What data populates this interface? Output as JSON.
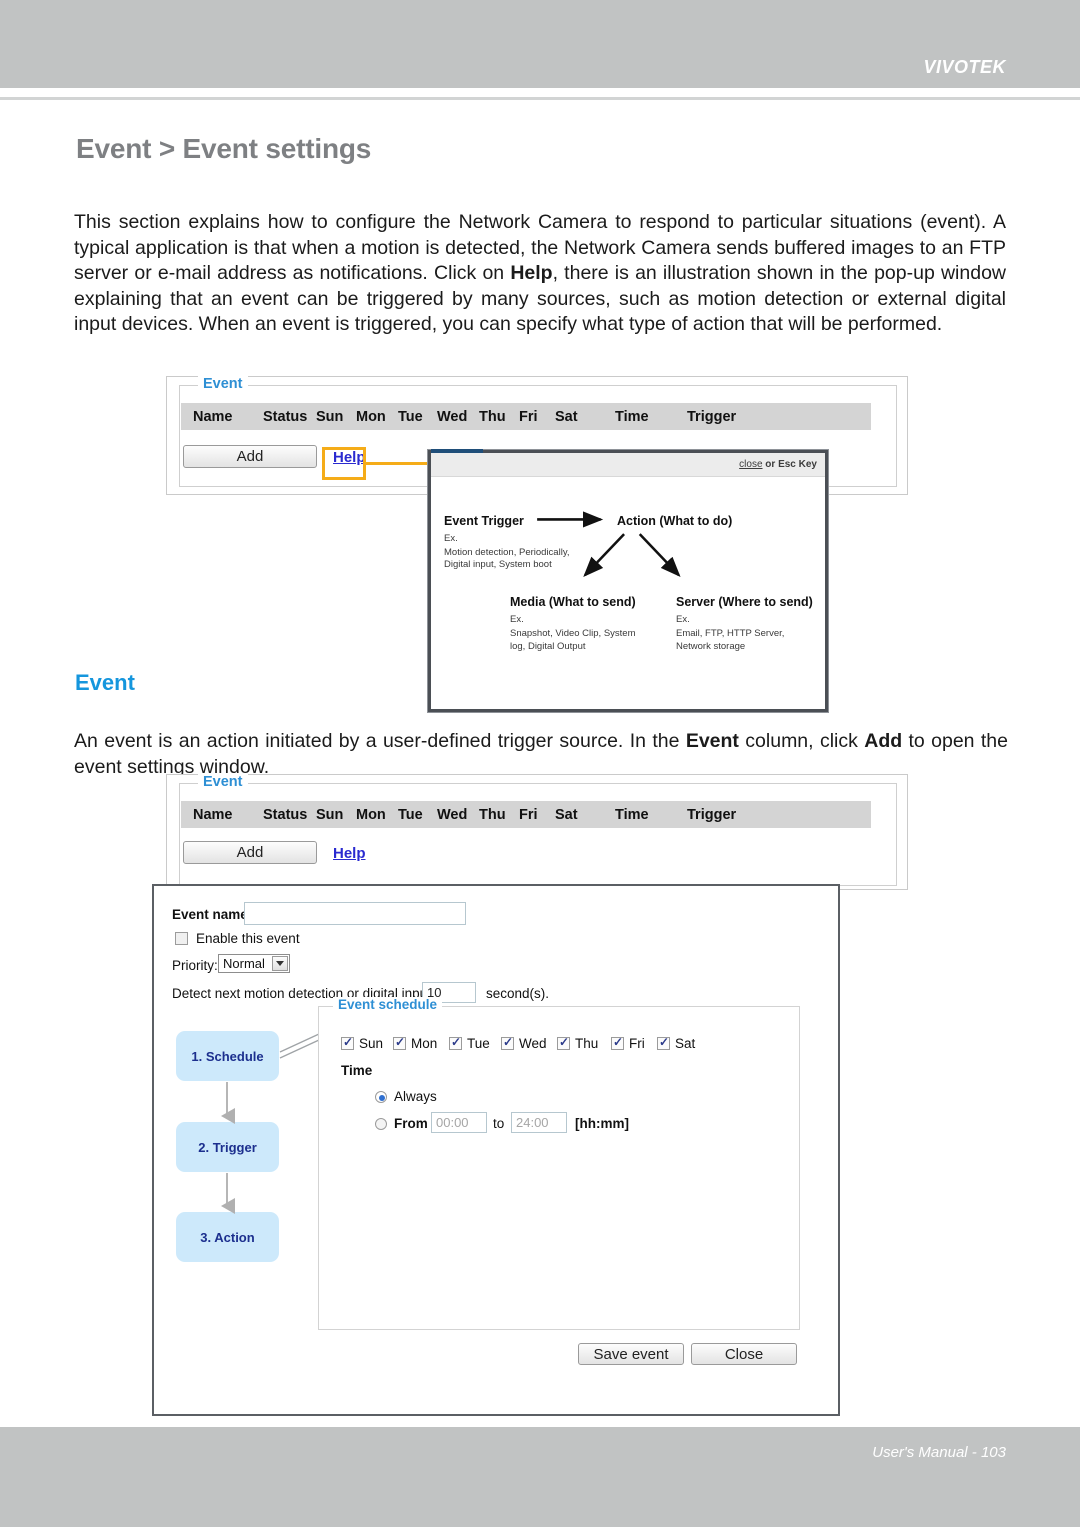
{
  "header": {
    "brand": "VIVOTEK"
  },
  "page": {
    "title": "Event > Event settings",
    "paragraph1_html": "This section explains how to configure the Network Camera to respond to particular situations (event). A typical application is that when a motion is detected, the Network Camera sends buffered images to an FTP server or e-mail address as notifications. Click on <b>Help</b>, there is an illustration shown in the pop-up window explaining that an event can be triggered by many sources, such as motion detection or external digital input devices. When an event is triggered, you can specify what type of action that will be performed.",
    "section_heading": "Event",
    "paragraph2_html": "An event is an action initiated by a user-defined trigger source. In the <b>Event</b> column, click <b>Add</b> to open the event settings window.",
    "footer": "User's Manual - 103"
  },
  "event_panel": {
    "legend": "Event",
    "columns": [
      "Name",
      "Status",
      "Sun",
      "Mon",
      "Tue",
      "Wed",
      "Thu",
      "Fri",
      "Sat",
      "Time",
      "Trigger"
    ],
    "add_label": "Add",
    "help_label": "Help"
  },
  "help_popup": {
    "close_text_link": "close",
    "close_text_rest": " or Esc Key",
    "nodes": [
      {
        "title": "Event Trigger",
        "ex_label": "Ex.",
        "ex_lines": [
          "Motion detection, Periodically,",
          "Digital input, System boot"
        ]
      },
      {
        "title": "Action (What to do)",
        "ex_label": "",
        "ex_lines": []
      },
      {
        "title": "Media (What to send)",
        "ex_label": "Ex.",
        "ex_lines": [
          "Snapshot, Video Clip, System",
          "log, Digital Output"
        ]
      },
      {
        "title": "Server (Where to send)",
        "ex_label": "Ex.",
        "ex_lines": [
          "Email, FTP, HTTP Server,",
          "Network storage"
        ]
      }
    ]
  },
  "settings_dialog": {
    "event_name_label": "Event name:",
    "event_name_value": "",
    "enable_label": "Enable this event",
    "enable_checked": false,
    "priority_label": "Priority:",
    "priority_value": "Normal",
    "priority_options": [
      "Normal"
    ],
    "detect_prefix": "Detect next motion detection or digital input after",
    "detect_value": "10",
    "detect_suffix": "second(s).",
    "steps": [
      "1. Schedule",
      "2. Trigger",
      "3. Action"
    ],
    "schedule": {
      "legend": "Event schedule",
      "days": [
        {
          "label": "Sun",
          "checked": true
        },
        {
          "label": "Mon",
          "checked": true
        },
        {
          "label": "Tue",
          "checked": true
        },
        {
          "label": "Wed",
          "checked": true
        },
        {
          "label": "Thu",
          "checked": true
        },
        {
          "label": "Fri",
          "checked": true
        },
        {
          "label": "Sat",
          "checked": true
        }
      ],
      "time_label": "Time",
      "always_label": "Always",
      "always_selected": true,
      "from_label": "From",
      "from_value": "00:00",
      "to_label": "to",
      "to_value": "24:00",
      "format_hint": "[hh:mm]"
    },
    "save_label": "Save event",
    "close_label": "Close"
  },
  "colors": {
    "header_gray": "#c1c3c3",
    "accent_blue": "#1596dd",
    "highlight_orange": "#f5ac18",
    "step_blue": "#cde9fb"
  }
}
